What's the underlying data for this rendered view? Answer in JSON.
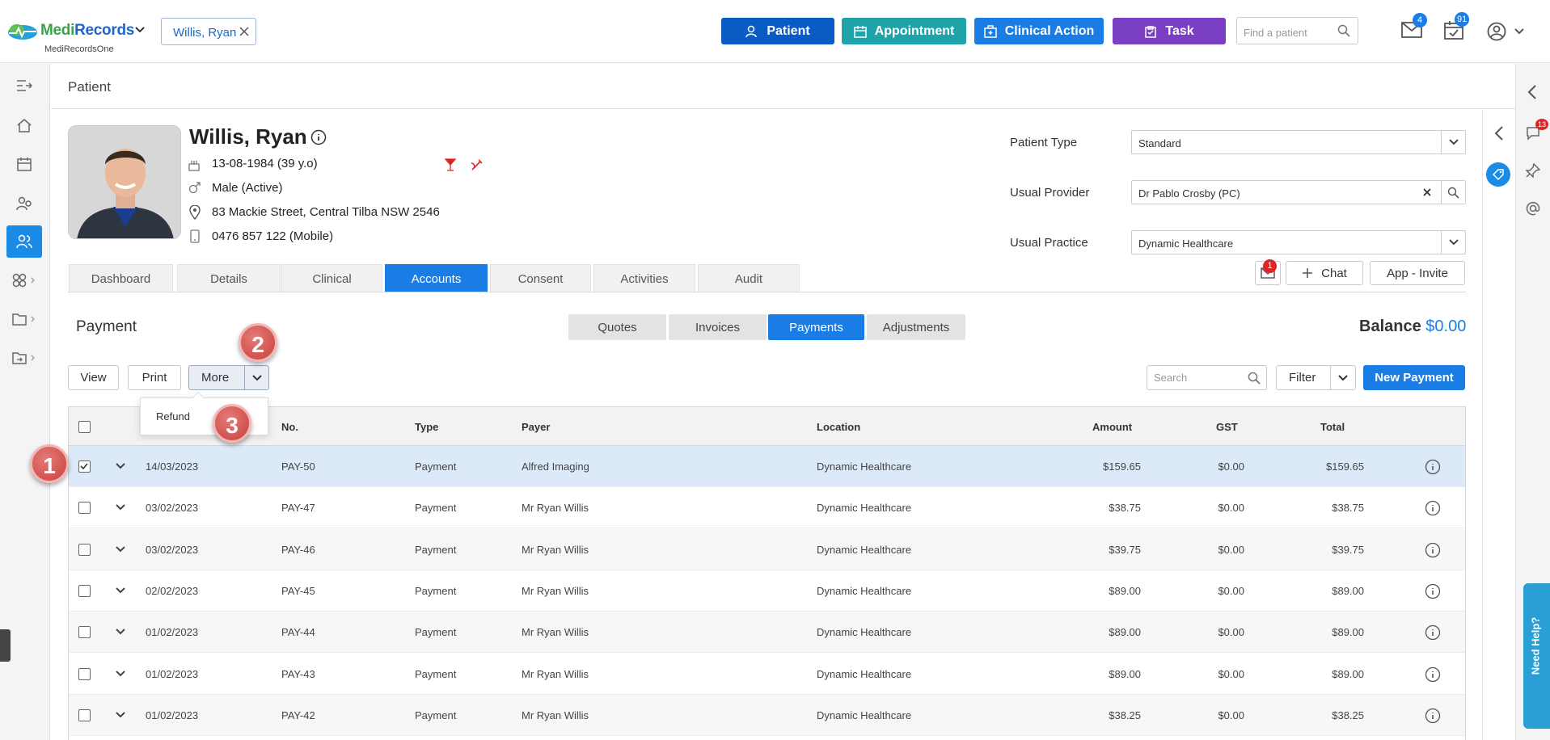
{
  "app": {
    "brand": "MediRecords",
    "sub": "MediRecordsOne"
  },
  "topbar": {
    "patient_chip": "Willis, Ryan",
    "buttons": {
      "patient": "Patient",
      "appointment": "Appointment",
      "clinical_action": "Clinical Action",
      "task": "Task"
    },
    "colors": {
      "patient": "#0b5bc4",
      "appointment": "#1fa3a8",
      "clinical_action": "#1a7de6",
      "task": "#7b3fc4"
    },
    "find_placeholder": "Find a patient",
    "mail_badge": "4",
    "tasks_badge": "91"
  },
  "page": {
    "title": "Patient"
  },
  "patient": {
    "name": "Willis, Ryan",
    "dob": "13-08-1984 (39 y.o)",
    "gender": "Male (Active)",
    "address": "83 Mackie Street, Central Tilba NSW 2546",
    "phone": "0476 857 122 (Mobile)"
  },
  "fields": {
    "patient_type_label": "Patient Type",
    "patient_type": "Standard",
    "provider_label": "Usual Provider",
    "provider": "Dr Pablo Crosby (PC)",
    "practice_label": "Usual Practice",
    "practice": "Dynamic Healthcare"
  },
  "tabs": [
    "Dashboard",
    "Details",
    "Clinical",
    "Accounts",
    "Consent",
    "Activities",
    "Audit"
  ],
  "actions": {
    "chat": "Chat",
    "app_invite": "App - Invite",
    "mail_badge": "1"
  },
  "right_badge": "13",
  "payment": {
    "title": "Payment",
    "segments": [
      "Quotes",
      "Invoices",
      "Payments",
      "Adjustments"
    ],
    "balance_label": "Balance",
    "balance_value": "$0.00",
    "view": "View",
    "print": "Print",
    "more": "More",
    "search_placeholder": "Search",
    "filter": "Filter",
    "new_payment": "New Payment",
    "menu_refund": "Refund"
  },
  "columns": [
    "No.",
    "Type",
    "Payer",
    "Location",
    "Amount",
    "GST",
    "Total"
  ],
  "rows": [
    {
      "date": "14/03/2023",
      "no": "PAY-50",
      "type": "Payment",
      "payer": "Alfred Imaging",
      "location": "Dynamic Healthcare",
      "amount": "$159.65",
      "gst": "$0.00",
      "total": "$159.65"
    },
    {
      "date": "03/02/2023",
      "no": "PAY-47",
      "type": "Payment",
      "payer": "Mr Ryan Willis",
      "location": "Dynamic Healthcare",
      "amount": "$38.75",
      "gst": "$0.00",
      "total": "$38.75"
    },
    {
      "date": "03/02/2023",
      "no": "PAY-46",
      "type": "Payment",
      "payer": "Mr Ryan Willis",
      "location": "Dynamic Healthcare",
      "amount": "$39.75",
      "gst": "$0.00",
      "total": "$39.75"
    },
    {
      "date": "02/02/2023",
      "no": "PAY-45",
      "type": "Payment",
      "payer": "Mr Ryan Willis",
      "location": "Dynamic Healthcare",
      "amount": "$89.00",
      "gst": "$0.00",
      "total": "$89.00"
    },
    {
      "date": "01/02/2023",
      "no": "PAY-44",
      "type": "Payment",
      "payer": "Mr Ryan Willis",
      "location": "Dynamic Healthcare",
      "amount": "$89.00",
      "gst": "$0.00",
      "total": "$89.00"
    },
    {
      "date": "01/02/2023",
      "no": "PAY-43",
      "type": "Payment",
      "payer": "Mr Ryan Willis",
      "location": "Dynamic Healthcare",
      "amount": "$89.00",
      "gst": "$0.00",
      "total": "$89.00"
    },
    {
      "date": "01/02/2023",
      "no": "PAY-42",
      "type": "Payment",
      "payer": "Mr Ryan Willis",
      "location": "Dynamic Healthcare",
      "amount": "$38.25",
      "gst": "$0.00",
      "total": "$38.25"
    }
  ],
  "callouts": [
    "1",
    "2",
    "3"
  ],
  "help": "Need Help?"
}
